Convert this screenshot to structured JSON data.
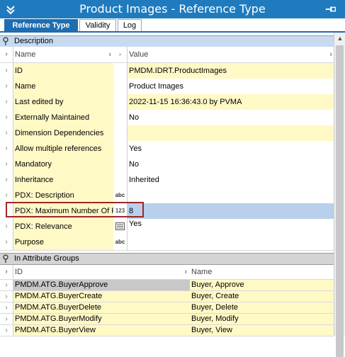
{
  "window": {
    "title": "Product Images - Reference Type"
  },
  "tabs": [
    {
      "label": "Reference Type",
      "active": true
    },
    {
      "label": "Validity",
      "active": false
    },
    {
      "label": "Log",
      "active": false
    }
  ],
  "description_section": {
    "title": "Description",
    "columns": {
      "name": "Name",
      "value": "Value"
    },
    "rows": [
      {
        "name": "ID",
        "value": "PMDM.IDRT.ProductImages",
        "icon": "",
        "style": "yellow"
      },
      {
        "name": "Name",
        "value": "Product Images",
        "icon": "",
        "style": "white"
      },
      {
        "name": "Last edited by",
        "value": "2022-11-15 16:36:43.0 by PVMA",
        "icon": "",
        "style": "yellow"
      },
      {
        "name": "Externally Maintained",
        "value": "No",
        "icon": "",
        "style": "white"
      },
      {
        "name": "Dimension Dependencies",
        "value": "",
        "icon": "",
        "style": "yellow"
      },
      {
        "name": "Allow multiple references",
        "value": "Yes",
        "icon": "",
        "style": "white"
      },
      {
        "name": "Mandatory",
        "value": "No",
        "icon": "",
        "style": "white"
      },
      {
        "name": "Inheritance",
        "value": "Inherited",
        "icon": "",
        "style": "white"
      },
      {
        "name": "PDX: Description",
        "value": "",
        "icon": "abc",
        "style": "white"
      },
      {
        "name": "PDX: Maximum Number Of Re",
        "value": "8",
        "icon": "123",
        "style": "blue"
      },
      {
        "name": "PDX: Relevance",
        "value": "Yes",
        "icon": "list",
        "style": "white"
      },
      {
        "name": "Purpose",
        "value": "",
        "icon": "abc",
        "style": "white"
      }
    ]
  },
  "attribute_groups_section": {
    "title": "In Attribute Groups",
    "columns": {
      "id": "ID",
      "name": "Name"
    },
    "rows": [
      {
        "id": "PMDM.ATG.BuyerApprove",
        "name": "Buyer, Approve",
        "selected": true
      },
      {
        "id": "PMDM.ATG.BuyerCreate",
        "name": "Buyer, Create",
        "selected": false
      },
      {
        "id": "PMDM.ATG.BuyerDelete",
        "name": "Buyer, Delete",
        "selected": false
      },
      {
        "id": "PMDM.ATG.BuyerModify",
        "name": "Buyer, Modify",
        "selected": false
      },
      {
        "id": "PMDM.ATG.BuyerView",
        "name": "Buyer, View",
        "selected": false
      }
    ]
  },
  "colors": {
    "titlebar": "#1f7bbd",
    "active_tab": "#1f6db0",
    "cell_yellow": "#fff9c6",
    "cell_blue": "#b8d0ec",
    "section_bg": "#c8daf0",
    "section_bg_grey": "#d4d4d4",
    "highlight_border": "#a0262a"
  }
}
